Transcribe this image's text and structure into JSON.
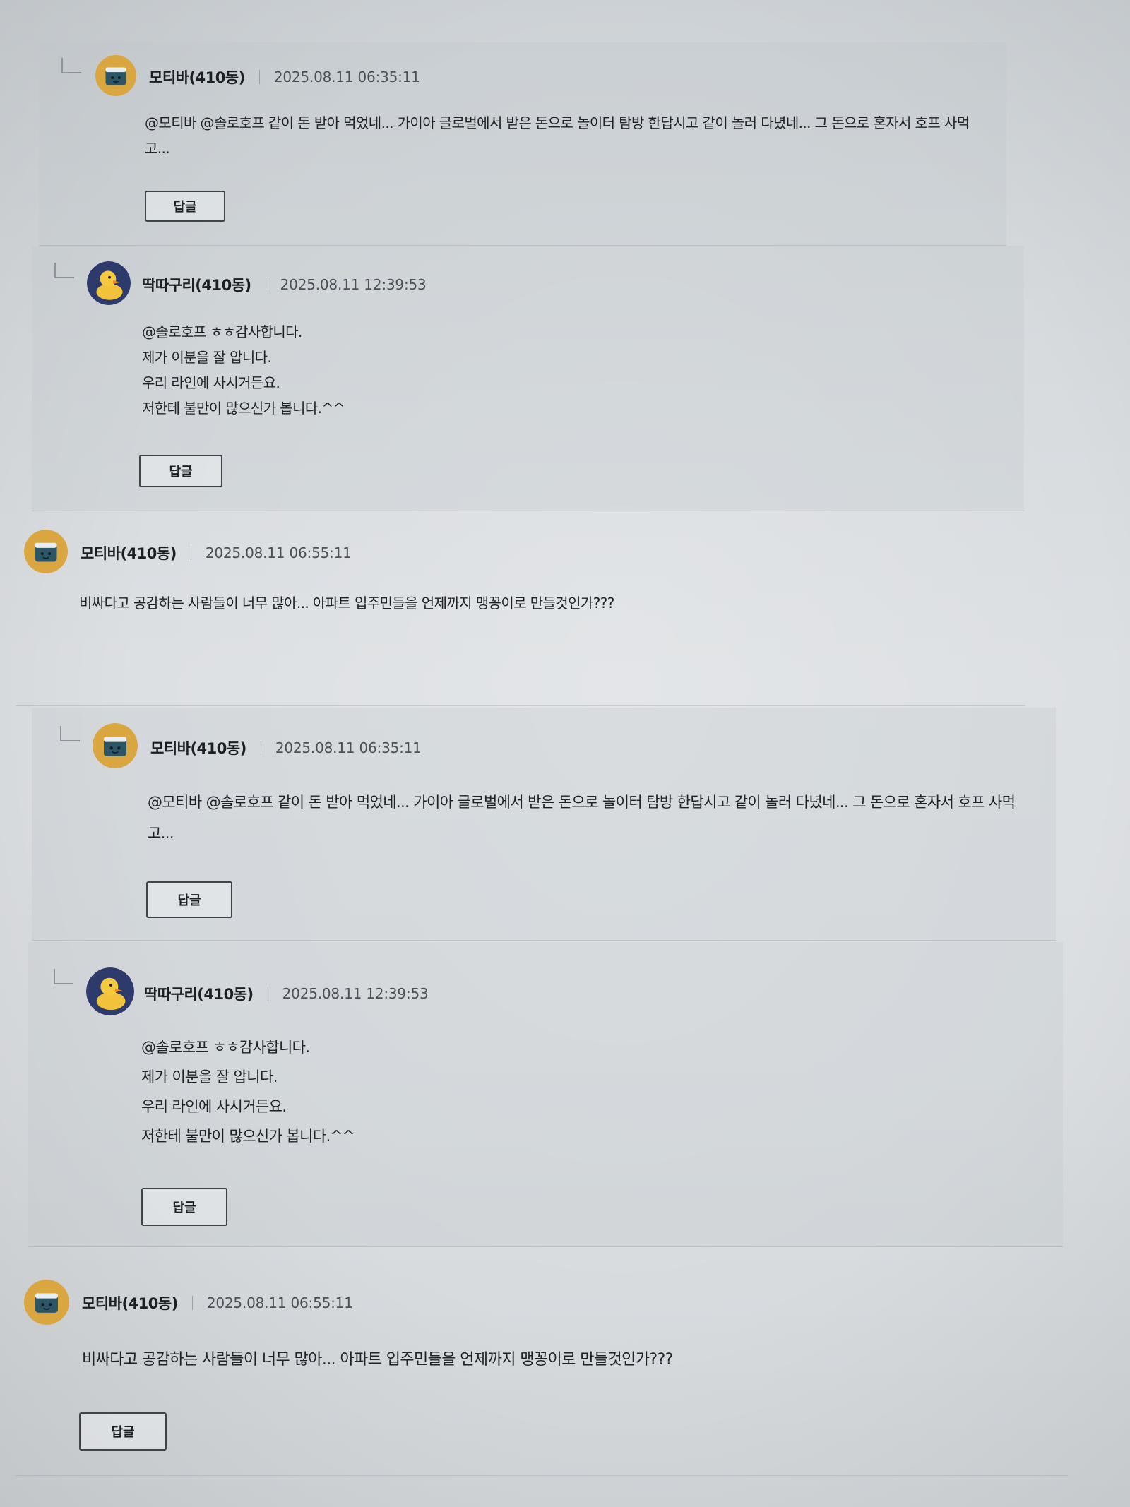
{
  "comments": [
    {
      "author": "모티바(410동)",
      "date": "2025.08.11 06:35:11",
      "lines": [
        "@모티바 @솔로호프 같이 돈 받아 먹었네... 가이아 글로벌에서 받은 돈으로 놀이터 탐방 한답시고 같이 놀러 다녔네... 그 돈으로 혼자서 호프 사먹",
        "고..."
      ],
      "reply_label": "답글"
    },
    {
      "author": "딱따구리(410동)",
      "date": "2025.08.11 12:39:53",
      "lines": [
        "@솔로호프 ㅎㅎ감사합니다.",
        "제가 이분을 잘 압니다.",
        "우리 라인에 사시거든요.",
        "저한테 불만이 많으신가 봅니다.^^"
      ],
      "reply_label": "답글"
    },
    {
      "author": "모티바(410동)",
      "date": "2025.08.11 06:55:11",
      "lines": [
        "비싸다고 공감하는 사람들이 너무 많아... 아파트 입주민들을 언제까지 맹꽁이로 만들것인가???"
      ]
    },
    {
      "author": "모티바(410동)",
      "date": "2025.08.11 06:35:11",
      "lines": [
        "@모티바 @솔로호프 같이 돈 받아 먹었네... 가이아 글로벌에서 받은 돈으로 놀이터 탐방 한답시고 같이 놀러 다녔네... 그 돈으로 혼자서 호프 사먹",
        "고..."
      ],
      "reply_label": "답글"
    },
    {
      "author": "딱따구리(410동)",
      "date": "2025.08.11 12:39:53",
      "lines": [
        "@솔로호프 ㅎㅎ감사합니다.",
        "제가 이분을 잘 압니다.",
        "우리 라인에 사시거든요.",
        "저한테 불만이 많으신가 봅니다.^^"
      ],
      "reply_label": "답글"
    },
    {
      "author": "모티바(410동)",
      "date": "2025.08.11 06:55:11",
      "lines": [
        "비싸다고 공감하는 사람들이 너무 많아... 아파트 입주민들을 언제까지 맹꽁이로 만들것인가???"
      ],
      "reply_label": "답글"
    }
  ]
}
